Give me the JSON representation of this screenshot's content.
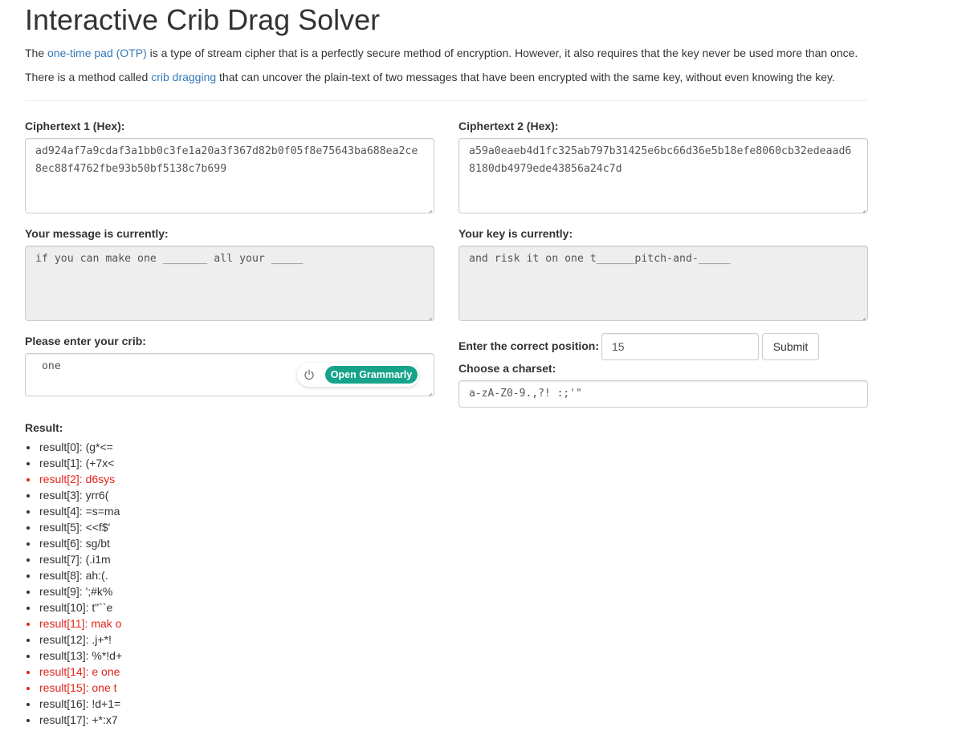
{
  "page": {
    "title": "Interactive Crib Drag Solver",
    "intro1": {
      "before": "The ",
      "link": "one-time pad (OTP)",
      "after": " is a type of stream cipher that is a perfectly secure method of encryption. However, it also requires that the key never be used more than once."
    },
    "intro2": {
      "before": "There is a method called ",
      "link": "crib dragging",
      "after": " that can uncover the plain-text of two messages that have been encrypted with the same key, without even knowing the key."
    }
  },
  "form": {
    "ct1_label": "Ciphertext 1 (Hex):",
    "ct1_value": "ad924af7a9cdaf3a1bb0c3fe1a20a3f367d82b0f05f8e75643ba688ea2ce8ec88f4762fbe93b50bf5138c7b699",
    "ct2_label": "Ciphertext 2 (Hex):",
    "ct2_value": "a59a0eaeb4d1fc325ab797b31425e6bc66d36e5b18efe8060cb32edeaad68180db4979ede43856a24c7d",
    "message_label": "Your message is currently:",
    "message_value": "if you can make one _______ all your _____",
    "key_label": "Your key is currently:",
    "key_value": "and risk it on one t______pitch-and-_____",
    "crib_label": "Please enter your crib:",
    "crib_value": " one",
    "position_label": "Enter the correct position:",
    "position_value": "15",
    "submit_label": "Submit",
    "charset_label": "Choose a charset:",
    "charset_value": "a-zA-Z0-9.,?! :;'\"",
    "grammarly_label": "Open Grammarly",
    "highlight_color": "#e2231a"
  },
  "results": {
    "label": "Result:",
    "items": [
      {
        "text": "result[0]: (g*<=",
        "highlighted": false
      },
      {
        "text": "result[1]: (+7x<",
        "highlighted": false
      },
      {
        "text": "result[2]: d6sys",
        "highlighted": true
      },
      {
        "text": "result[3]: yrr6(",
        "highlighted": false
      },
      {
        "text": "result[4]: =s=ma",
        "highlighted": false
      },
      {
        "text": "result[5]: <<f$'",
        "highlighted": false
      },
      {
        "text": "result[6]: sg/bt",
        "highlighted": false
      },
      {
        "text": "result[7]: (.i1m",
        "highlighted": false
      },
      {
        "text": "result[8]: ah:(.",
        "highlighted": false
      },
      {
        "text": "result[9]: ';#k%",
        "highlighted": false
      },
      {
        "text": "result[10]: t\"``e",
        "highlighted": false
      },
      {
        "text": "result[11]: mak o",
        "highlighted": true
      },
      {
        "text": "result[12]: .j+*!",
        "highlighted": false
      },
      {
        "text": "result[13]: %*!d+",
        "highlighted": false
      },
      {
        "text": "result[14]: e one",
        "highlighted": true
      },
      {
        "text": "result[15]: one t",
        "highlighted": true
      },
      {
        "text": "result[16]: !d+1=",
        "highlighted": false
      },
      {
        "text": "result[17]: +*:x7",
        "highlighted": false
      }
    ]
  }
}
